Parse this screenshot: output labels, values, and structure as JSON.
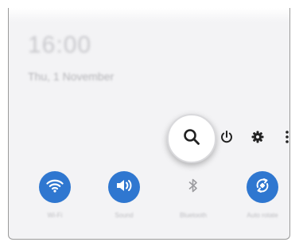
{
  "lock": {
    "time": "16:00",
    "date": "Thu, 1 November"
  },
  "header_icons": {
    "search": "search-icon",
    "power": "power-icon",
    "settings": "gear-icon",
    "more": "more-options-icon"
  },
  "colors": {
    "accent": "#2f77d0",
    "panel_bg": "#f3f3f5",
    "icon_dark": "#222222"
  },
  "quick_settings": [
    {
      "label": "Wi-Fi",
      "icon": "wifi-icon",
      "state": "on"
    },
    {
      "label": "Sound",
      "icon": "sound-icon",
      "state": "on"
    },
    {
      "label": "Bluetooth",
      "icon": "bluetooth-icon",
      "state": "off"
    },
    {
      "label": "Auto rotate",
      "icon": "auto-rotate-icon",
      "state": "on"
    }
  ]
}
